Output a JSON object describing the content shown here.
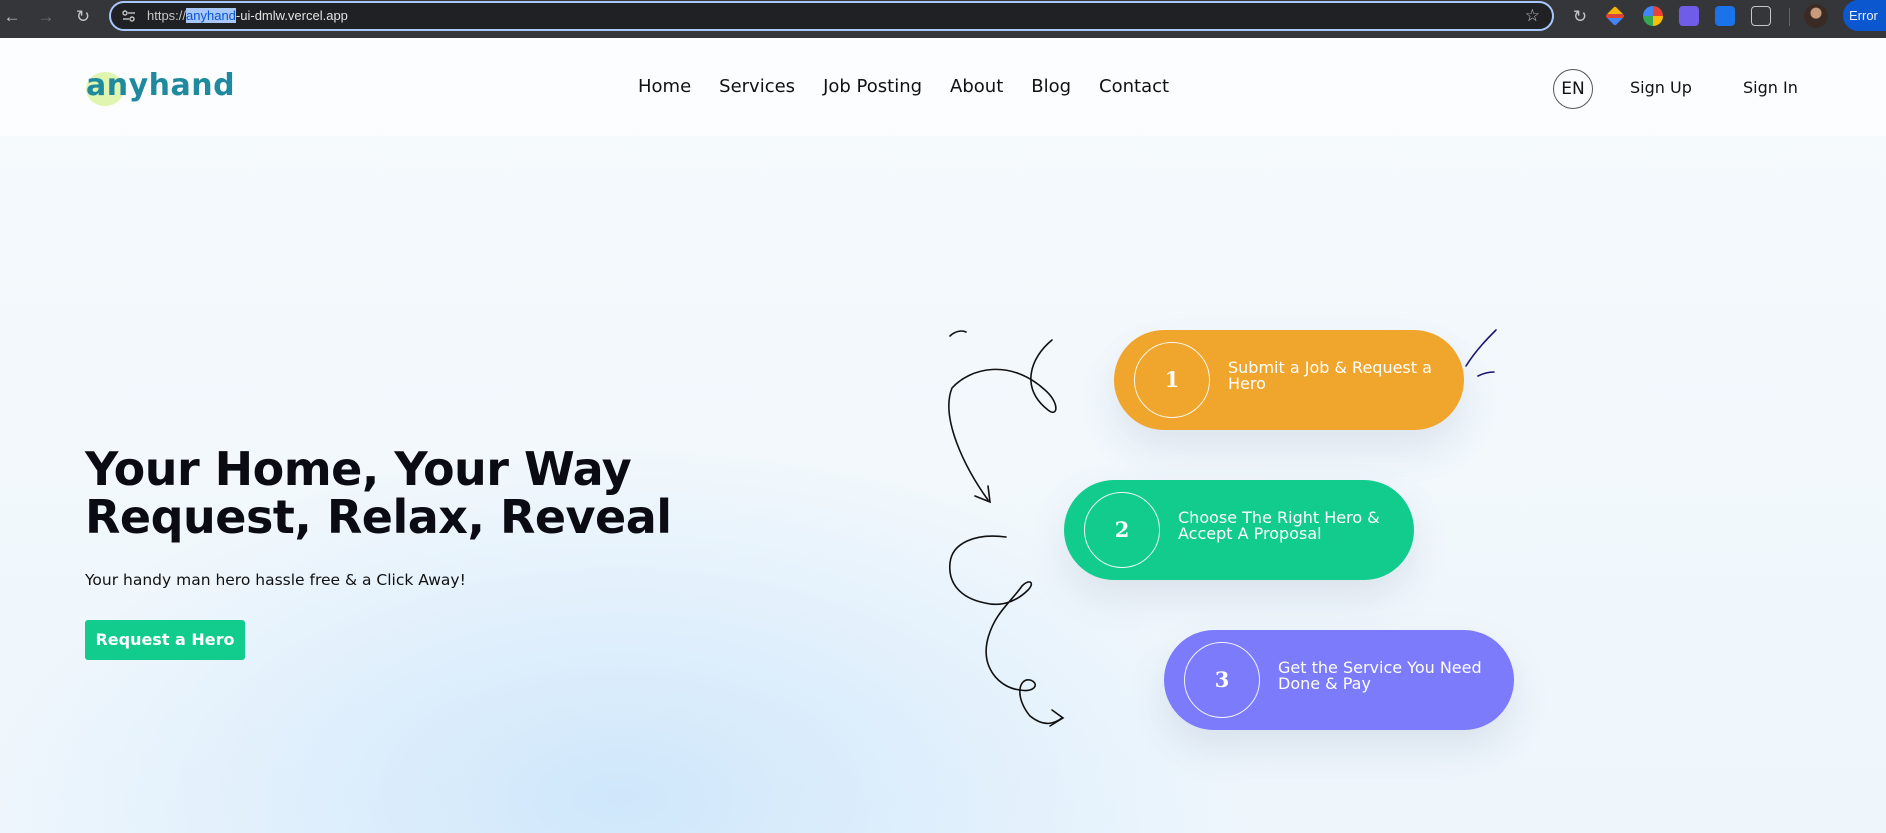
{
  "browser": {
    "url_prefix": "https://",
    "url_selected": "anyhand",
    "url_rest": "-ui-dmlw.vercel.app",
    "error_label": "Error"
  },
  "site": {
    "logo": "anyhand",
    "nav": [
      "Home",
      "Services",
      "Job Posting",
      "About",
      "Blog",
      "Contact"
    ],
    "language": "EN",
    "sign_up": "Sign Up",
    "sign_in": "Sign In"
  },
  "hero": {
    "title_line1": "Your Home, Your Way",
    "title_line2": "Request, Relax, Reveal",
    "subtitle": "Your handy man hero hassle free & a Click Away!",
    "cta": "Request a Hero"
  },
  "steps": [
    {
      "number": "1",
      "text": "Submit a Job & Request a Hero",
      "color": "#f0a62c"
    },
    {
      "number": "2",
      "text": "Choose The Right Hero & Accept A Proposal",
      "color": "#12cc8e"
    },
    {
      "number": "3",
      "text": "Get the Service You Need Done & Pay",
      "color": "#7b7bfb"
    }
  ],
  "colors": {
    "brand": "#1f8a9e",
    "accent_green": "#12cc8e"
  }
}
